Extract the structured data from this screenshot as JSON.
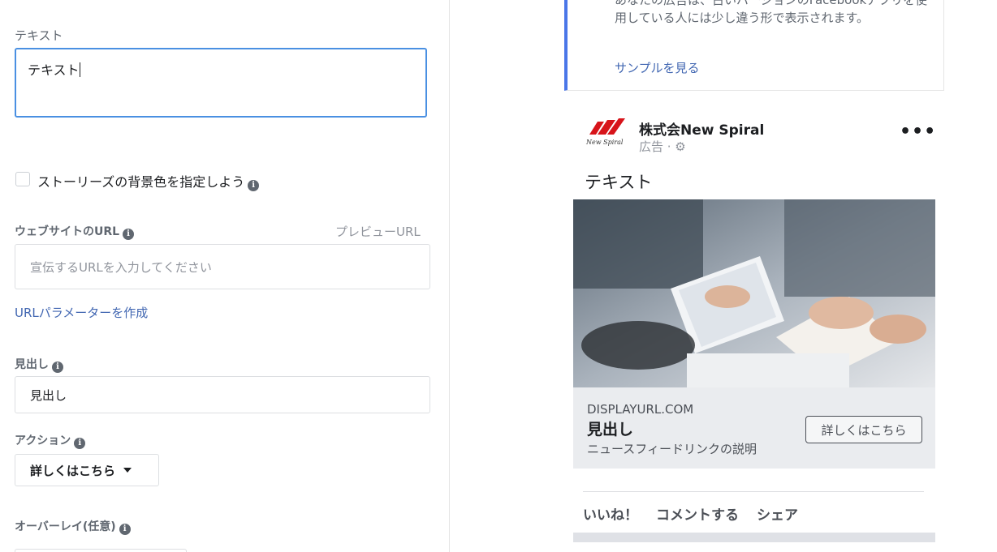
{
  "form": {
    "text_label": "テキスト",
    "text_value": "テキスト",
    "story_bg_label": "ストーリーズの背景色を指定しよう",
    "website_url_label": "ウェブサイトのURL",
    "preview_url_link": "プレビューURL",
    "url_placeholder": "宣伝するURLを入力してください",
    "url_params_link": "URLパラメーターを作成",
    "headline_label": "見出し",
    "headline_value": "見出し",
    "action_label": "アクション",
    "action_value": "詳しくはこちら",
    "overlay_label": "オーバーレイ(任意)",
    "info_glyph": "i"
  },
  "preview": {
    "notice_text": "あなたの広告は、古いバージョンのFacebookアプリを使用している人には少し違う形で表示されます。",
    "notice_link": "サンプルを見る",
    "page_name": "株式会New Spiral",
    "sponsored": "広告 · ⚙",
    "logo_text": "New Spiral",
    "more_glyph": "•••",
    "post_text": "テキスト",
    "link_domain": "DISPLAYURL.COM",
    "link_headline": "見出し",
    "link_description": "ニュースフィードリンクの説明",
    "cta_label": "詳しくはこちら",
    "actions": [
      "いいね！",
      "コメントする",
      "シェア"
    ]
  },
  "colors": {
    "focus_border": "#4a90e2",
    "link": "#4267b2",
    "notice_accent": "#4a76e8",
    "logo_red": "#d7141a"
  }
}
